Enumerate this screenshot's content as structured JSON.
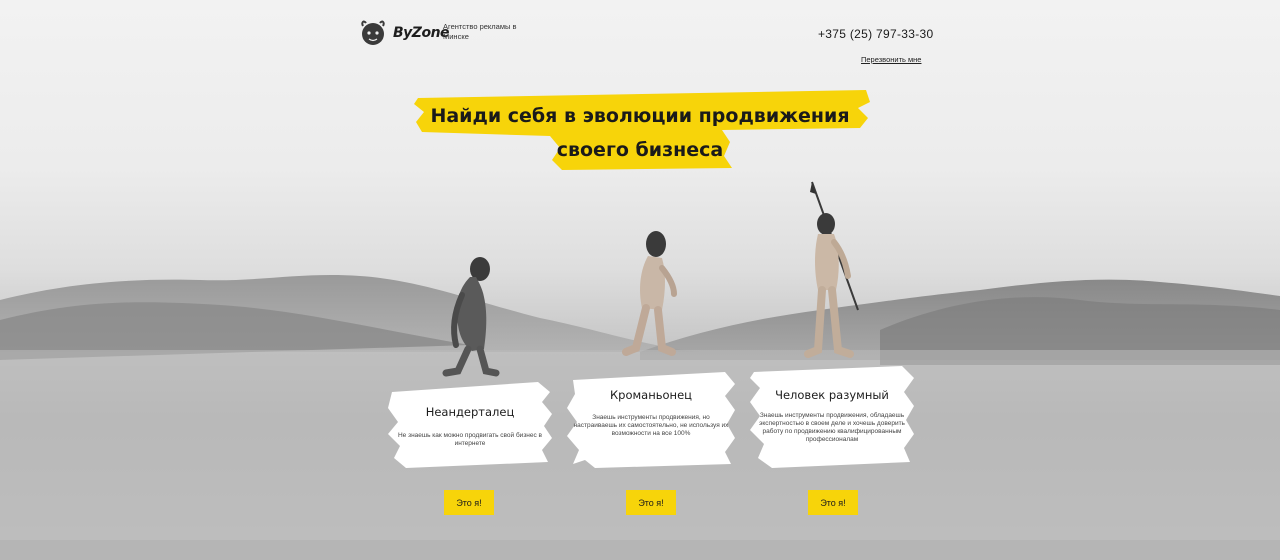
{
  "header": {
    "brand": "ByZone",
    "tagline": "Агентство рекламы в Минске",
    "phone": "+375 (25) 797-33-30",
    "callback_link": "Перезвонить мне"
  },
  "hero": {
    "headline_line1": "Найди себя в эволюции продвижения",
    "headline_line2": "своего бизнеса"
  },
  "cards": [
    {
      "title": "Неандерталец",
      "description": "Не знаешь как можно продвигать свой бизнес в интернете",
      "button": "Это я!"
    },
    {
      "title": "Кроманьонец",
      "description": "Знаешь инструменты продвижения, но настраиваешь их самостоятельно, не используя их возможности на все 100%",
      "button": "Это я!"
    },
    {
      "title": "Человек разумный",
      "description": "Знаешь инструменты продвижения, обладаешь экспертностью в своем деле и хочешь доверить работу по продвижению квалифицированным профессионалам",
      "button": "Это я!"
    }
  ],
  "colors": {
    "accent": "#f7d40a",
    "text": "#1a1a1a"
  }
}
